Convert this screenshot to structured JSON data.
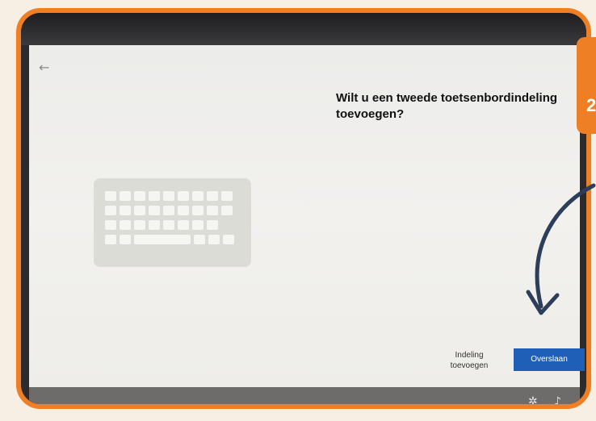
{
  "heading": {
    "title": "Wilt u een tweede toetsenbordindeling toevoegen?"
  },
  "buttons": {
    "secondary_label": "Indeling toevoegen",
    "primary_label": "Overslaan"
  },
  "step_badge": {
    "text": "2"
  },
  "colors": {
    "frame_orange": "#ef7f24",
    "primary_blue": "#1f5fb8",
    "arrow_navy": "#2c3e59"
  },
  "icons": {
    "back": "back-arrow-icon",
    "keyboard": "keyboard-icon",
    "taskbar_1": "accessibility-icon",
    "taskbar_2": "volume-icon"
  }
}
